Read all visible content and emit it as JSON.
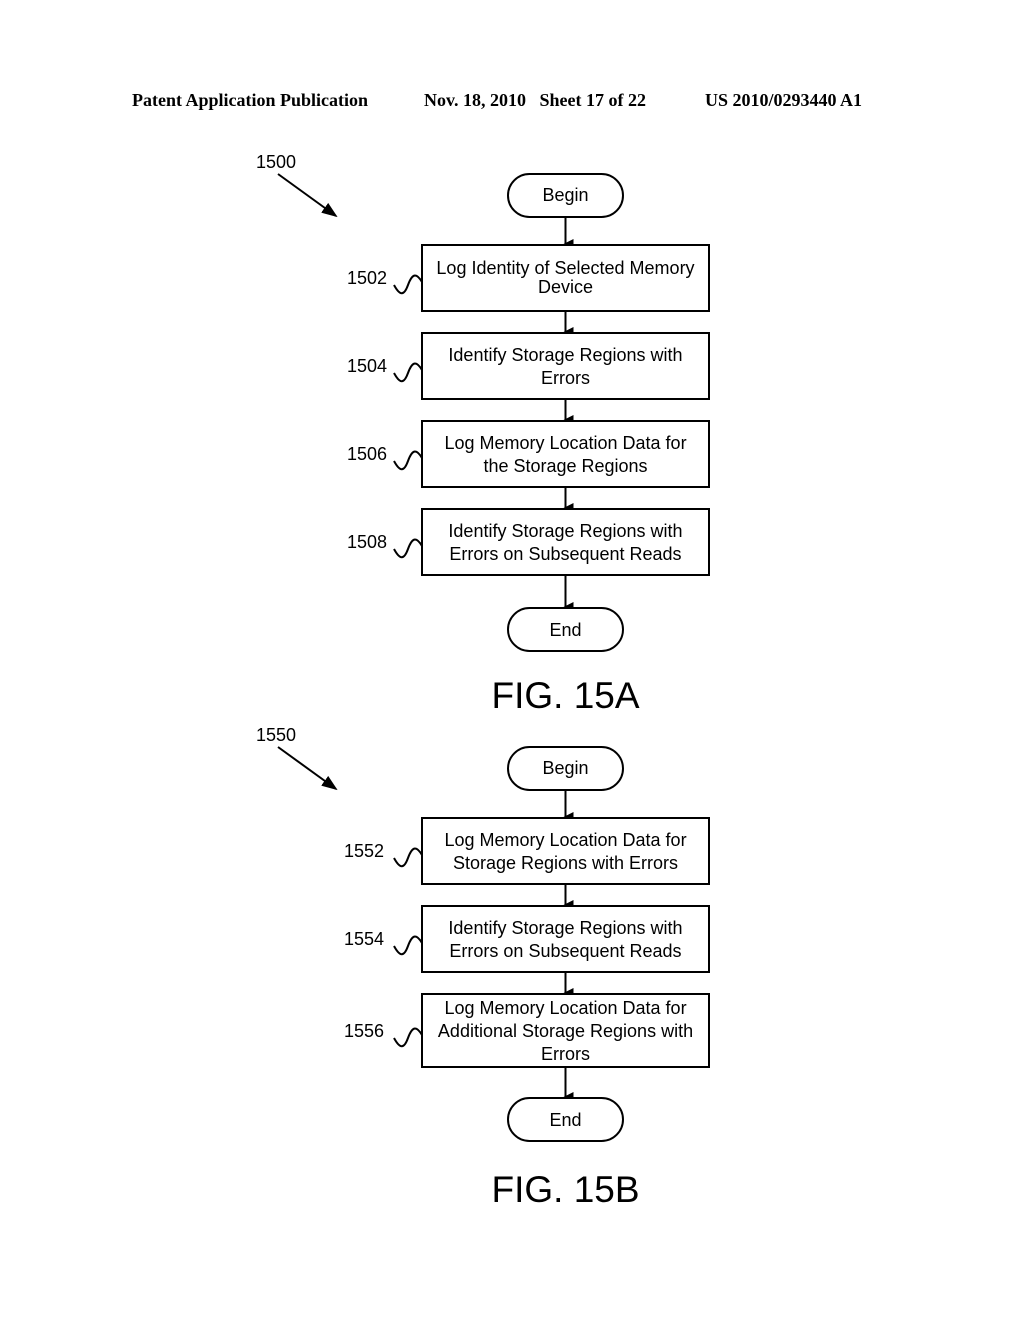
{
  "header": {
    "left": "Patent Application Publication",
    "date_sheet": "Nov. 18, 2010   Sheet 17 of 22",
    "pub_number": "US 2010/0293440 A1"
  },
  "figures": [
    {
      "title": "FIG. 15A",
      "ref": "1500",
      "begin": "Begin",
      "end": "End",
      "steps": [
        {
          "ref": "1502",
          "lines": [
            "Log Identity of Selected Memory",
            "Device"
          ]
        },
        {
          "ref": "1504",
          "lines": [
            "Identify Storage Regions with",
            "Errors"
          ]
        },
        {
          "ref": "1506",
          "lines": [
            "Log Memory Location Data for",
            "the Storage Regions"
          ]
        },
        {
          "ref": "1508",
          "lines": [
            "Identify Storage Regions with",
            "Errors on Subsequent Reads"
          ]
        }
      ]
    },
    {
      "title": "FIG. 15B",
      "ref": "1550",
      "begin": "Begin",
      "end": "End",
      "steps": [
        {
          "ref": "1552",
          "lines": [
            "Log Memory Location Data for",
            "Storage Regions with Errors"
          ]
        },
        {
          "ref": "1554",
          "lines": [
            "Identify Storage Regions with",
            "Errors on Subsequent Reads"
          ]
        },
        {
          "ref": "1556",
          "lines": [
            "Log Memory Location Data for",
            "Additional Storage Regions with",
            "Errors"
          ]
        }
      ]
    }
  ]
}
